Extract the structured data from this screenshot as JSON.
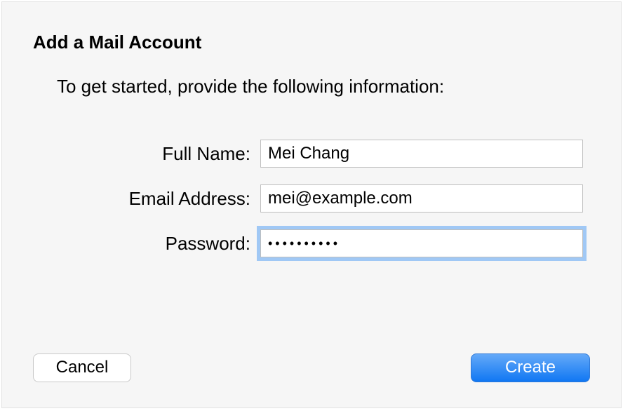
{
  "dialog": {
    "title": "Add a Mail Account",
    "subtitle": "To get started, provide the following information:"
  },
  "form": {
    "full_name": {
      "label": "Full Name:",
      "value": "Mei Chang"
    },
    "email": {
      "label": "Email Address:",
      "value": "mei@example.com"
    },
    "password": {
      "label": "Password:",
      "value": "••••••••••"
    }
  },
  "buttons": {
    "cancel": "Cancel",
    "create": "Create"
  }
}
